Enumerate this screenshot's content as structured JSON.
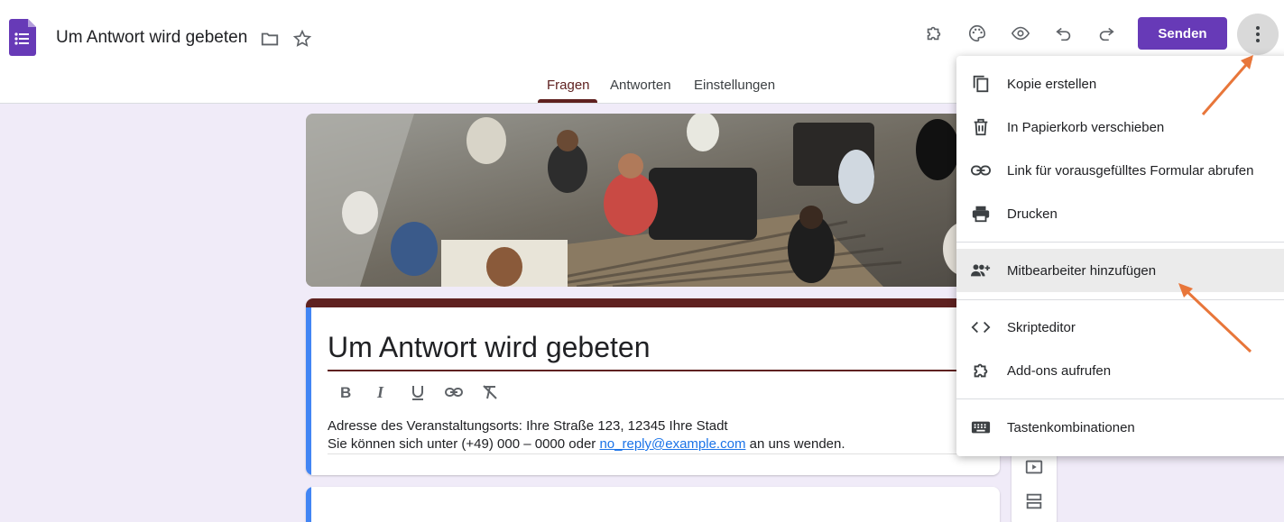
{
  "header": {
    "doc_title": "Um Antwort wird gebeten",
    "send_label": "Senden",
    "icons": [
      "folder-icon",
      "star-icon",
      "addon-icon",
      "palette-icon",
      "preview-icon",
      "undo-icon",
      "redo-icon",
      "more-vert-icon"
    ]
  },
  "tabs": [
    {
      "label": "Fragen",
      "active": true
    },
    {
      "label": "Antworten",
      "active": false
    },
    {
      "label": "Einstellungen",
      "active": false
    }
  ],
  "form": {
    "title": "Um Antwort wird gebeten",
    "description_line1": "Adresse des Veranstaltungsorts: Ihre Straße 123, 12345 Ihre Stadt",
    "description_line2_prefix": "Sie können sich unter (+49) 000 – 0000 oder ",
    "description_email": "no_reply@example.com",
    "description_line2_suffix": " an uns wenden."
  },
  "menu": {
    "items": [
      {
        "label": "Kopie erstellen",
        "icon": "copy-icon"
      },
      {
        "label": "In Papierkorb verschieben",
        "icon": "trash-icon"
      },
      {
        "label": "Link für vorausgefülltes Formular abrufen",
        "icon": "link-icon"
      },
      {
        "label": "Drucken",
        "icon": "print-icon"
      },
      {
        "label": "Mitbearbeiter hinzufügen",
        "icon": "add-people-icon",
        "highlighted": true
      },
      {
        "label": "Skripteditor",
        "icon": "code-icon"
      },
      {
        "label": "Add-ons aufrufen",
        "icon": "addon-icon"
      },
      {
        "label": "Tastenkombinationen",
        "icon": "keyboard-icon"
      }
    ]
  },
  "colors": {
    "accent": "#673ab7",
    "theme": "#5f2120",
    "link": "#1a73e8",
    "annotation_arrow": "#e8763a"
  }
}
